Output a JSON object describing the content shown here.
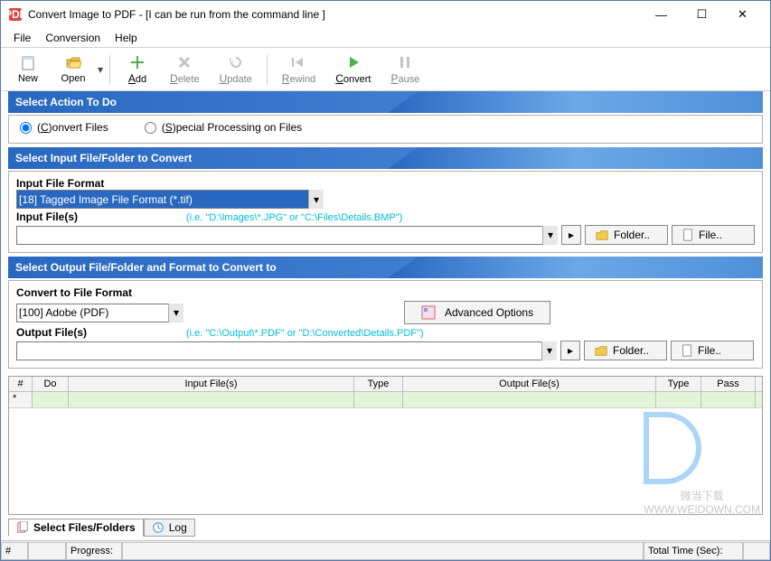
{
  "window": {
    "title": "Convert Image to PDF - [I can be run from the command line ]"
  },
  "menu": {
    "file": "File",
    "conversion": "Conversion",
    "help": "Help"
  },
  "toolbar": {
    "new": "New",
    "open": "Open",
    "add": "Add",
    "delete": "Delete",
    "update": "Update",
    "rewind": "Rewind",
    "convert": "Convert",
    "pause": "Pause"
  },
  "section_action": {
    "title": "Select Action To Do",
    "opt_convert": "(C)onvert Files",
    "opt_special": "(S)pecial Processing on Files"
  },
  "section_input": {
    "title": "Select Input File/Folder to Convert",
    "format_label": "Input File Format",
    "format_value": "[18] Tagged Image File Format (*.tif)",
    "files_label": "Input File(s)",
    "hint": "(i.e. \"D:\\Images\\*.JPG\" or \"C:\\Files\\Details.BMP\")",
    "folder_btn": "Folder..",
    "file_btn": "File.."
  },
  "section_output": {
    "title": "Select Output File/Folder and Format to Convert to",
    "format_label": "Convert to File Format",
    "format_value": "[100] Adobe (PDF)",
    "advanced_btn": "Advanced Options",
    "files_label": "Output File(s)",
    "hint": "(i.e. \"C:\\Output\\*.PDF\" or \"D:\\Converted\\Details.PDF\")",
    "folder_btn": "Folder..",
    "file_btn": "File.."
  },
  "grid": {
    "col_num": "#",
    "col_do": "Do",
    "col_in": "Input File(s)",
    "col_type1": "Type",
    "col_out": "Output File(s)",
    "col_type2": "Type",
    "col_pass": "Pass",
    "row1_marker": "*"
  },
  "tabs": {
    "select": "Select Files/Folders",
    "log": "Log"
  },
  "status": {
    "num": "#",
    "progress": "Progress:",
    "total": "Total Time (Sec):"
  },
  "watermark": {
    "text1": "微当下载",
    "text2": "WWW.WEIDOWN.COM"
  }
}
